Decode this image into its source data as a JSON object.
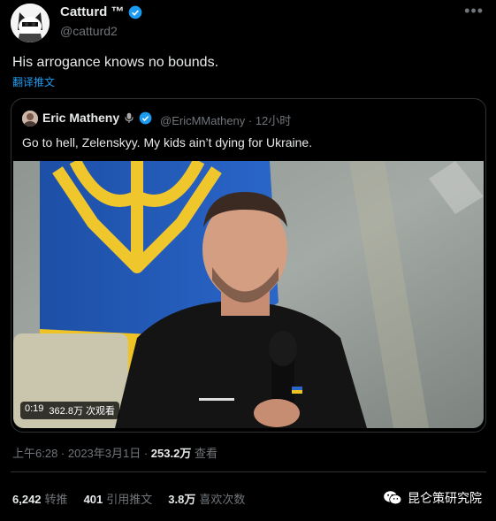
{
  "tweet": {
    "author_name": "Catturd ™",
    "author_handle": "@catturd2",
    "text": "His arrogance knows no bounds.",
    "translate_label": "翻译推文",
    "more_icon": "more-icon"
  },
  "quote": {
    "author_name": "Eric Matheny",
    "author_handle_time": "@EricMMatheny · 12小时",
    "text": "Go to hell, Zelenskyy. My kids ain’t dying for Ukraine.",
    "video": {
      "duration": "0:19",
      "views": "362.8万 次观看"
    }
  },
  "meta": {
    "time": "上午6:28 · 2023年3月1日 · ",
    "views_count": "253.2万",
    "views_label": "查看"
  },
  "stats": {
    "retweets_count": "6,242",
    "retweets_label": "转推",
    "quotes_count": "401",
    "quotes_label": "引用推文",
    "likes_count": "3.8万",
    "likes_label": "喜欢次数"
  },
  "watermark": {
    "label": "昆仑策研究院"
  },
  "colors": {
    "background": "#000000",
    "text": "#e7e9ea",
    "secondary": "#71767b",
    "link": "#1d9bf0",
    "verified": "#1d9bf0",
    "border": "#2f3336"
  }
}
